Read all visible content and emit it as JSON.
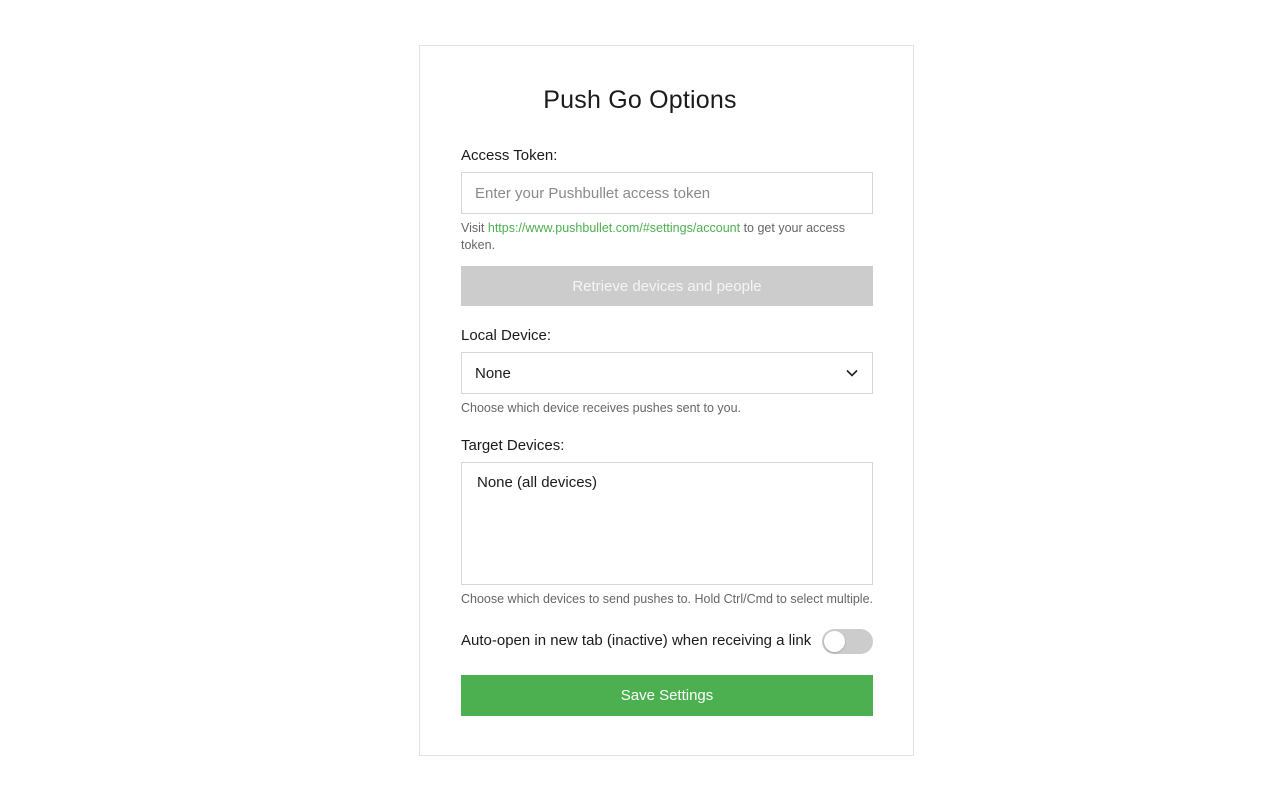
{
  "page": {
    "title": "Push Go Options"
  },
  "access_token": {
    "label": "Access Token:",
    "placeholder": "Enter your Pushbullet access token",
    "value": "",
    "hint_prefix": "Visit ",
    "hint_link": "https://www.pushbullet.com/#settings/account",
    "hint_suffix": " to get your access token."
  },
  "retrieve_button": {
    "label": "Retrieve devices and people",
    "enabled": false
  },
  "local_device": {
    "label": "Local Device:",
    "selected": "None",
    "hint": "Choose which device receives pushes sent to you."
  },
  "target_devices": {
    "label": "Target Devices:",
    "options": [
      "None (all devices)"
    ],
    "hint": "Choose which devices to send pushes to. Hold Ctrl/Cmd to select multiple."
  },
  "auto_open": {
    "label": "Auto-open in new tab (inactive) when receiving a link",
    "enabled": false
  },
  "save_button": {
    "label": "Save Settings"
  },
  "colors": {
    "accent": "#4caf50",
    "disabled_button": "#cccccc",
    "border": "#d6d6d6"
  },
  "icons": {
    "select_arrow": "chevron-down-icon"
  }
}
